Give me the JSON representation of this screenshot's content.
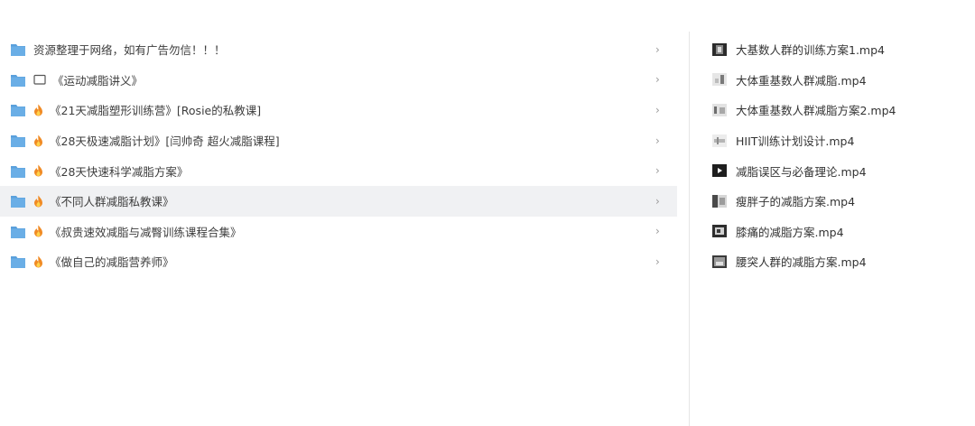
{
  "folder_list": {
    "items": [
      {
        "label": "资源整理于网络，如有广告勿信！！！",
        "prefix_icon": "none",
        "chevron": "›",
        "selected": false
      },
      {
        "label": "《运动减脂讲义》",
        "prefix_icon": "chat-icon",
        "chevron": "›",
        "selected": false
      },
      {
        "label": "《21天减脂塑形训练营》[Rosie的私教课]",
        "prefix_icon": "fire-icon",
        "chevron": "›",
        "selected": false
      },
      {
        "label": "《28天极速减脂计划》[闫帅奇 超火减脂课程]",
        "prefix_icon": "fire-icon",
        "chevron": "›",
        "selected": false
      },
      {
        "label": "《28天快速科学减脂方案》",
        "prefix_icon": "fire-icon",
        "chevron": "›",
        "selected": false
      },
      {
        "label": "《不同人群减脂私教课》",
        "prefix_icon": "fire-icon",
        "chevron": "›",
        "selected": true
      },
      {
        "label": "《叔贵速效减脂与减臀训练课程合集》",
        "prefix_icon": "fire-icon",
        "chevron": "›",
        "selected": false
      },
      {
        "label": "《做自己的减脂营养师》",
        "prefix_icon": "fire-icon",
        "chevron": "›",
        "selected": false
      }
    ]
  },
  "file_list": {
    "items": [
      {
        "name": "大基数人群的训练方案1.mp4",
        "thumb": "dark"
      },
      {
        "name": "大体重基数人群减脂.mp4",
        "thumb": "light"
      },
      {
        "name": "大体重基数人群减脂方案2.mp4",
        "thumb": "light"
      },
      {
        "name": "HIIT训练计划设计.mp4",
        "thumb": "light"
      },
      {
        "name": "减脂误区与必备理论.mp4",
        "thumb": "dark"
      },
      {
        "name": "瘦胖子的减脂方案.mp4",
        "thumb": "mid"
      },
      {
        "name": "膝痛的减脂方案.mp4",
        "thumb": "dark"
      },
      {
        "name": "腰突人群的减脂方案.mp4",
        "thumb": "dark"
      }
    ]
  },
  "colors": {
    "folder": "#5aa0dc",
    "folder_tab": "#4b8fcc",
    "selected_bg": "#f0f1f3",
    "fire_outer": "#f08a24",
    "fire_inner": "#ffd24a"
  }
}
